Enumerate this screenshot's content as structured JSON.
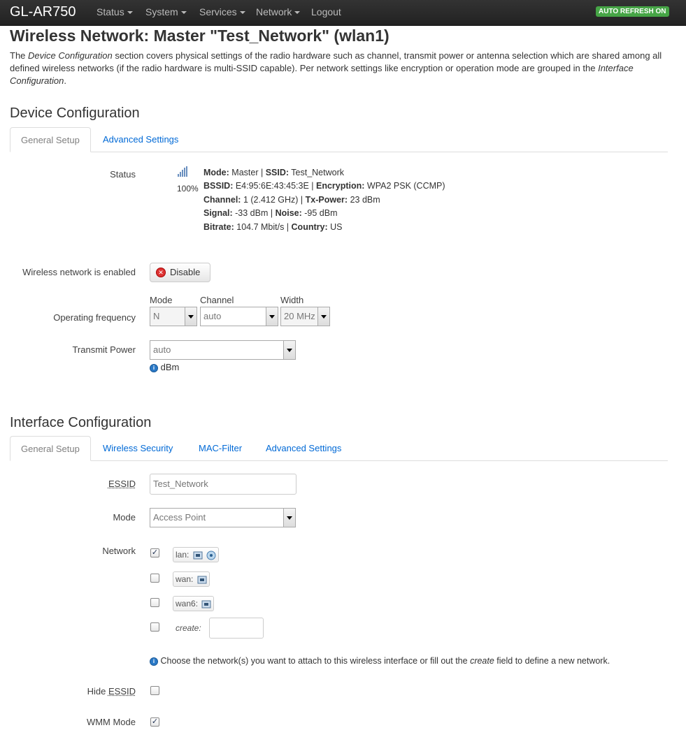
{
  "nav": {
    "brand": "GL-AR750",
    "menu": [
      "Status",
      "System",
      "Services",
      "Network",
      "Logout"
    ],
    "badge": "AUTO REFRESH ON"
  },
  "page": {
    "title": "Wireless Network: Master \"Test_Network\" (wlan1)",
    "desc_p1": "The ",
    "desc_i1": "Device Configuration",
    "desc_p2": " section covers physical settings of the radio hardware such as channel, transmit power or antenna selection which are shared among all defined wireless networks (if the radio hardware is multi-SSID capable). Per network settings like encryption or operation mode are grouped in the ",
    "desc_i2": "Interface Configuration",
    "desc_p3": "."
  },
  "device": {
    "heading": "Device Configuration",
    "tabs": [
      "General Setup",
      "Advanced Settings"
    ],
    "status_label": "Status",
    "signal_percent": "100%",
    "status_lines": [
      [
        {
          "k": "Mode:",
          "v": " Master | "
        },
        {
          "k": "SSID:",
          "v": " Test_Network"
        }
      ],
      [
        {
          "k": "BSSID:",
          "v": " E4:95:6E:43:45:3E | "
        },
        {
          "k": "Encryption:",
          "v": " WPA2 PSK (CCMP)"
        }
      ],
      [
        {
          "k": "Channel:",
          "v": " 1 (2.412 GHz) | "
        },
        {
          "k": "Tx-Power:",
          "v": " 23 dBm"
        }
      ],
      [
        {
          "k": "Signal:",
          "v": " -33 dBm | "
        },
        {
          "k": "Noise:",
          "v": " -95 dBm"
        }
      ],
      [
        {
          "k": "Bitrate:",
          "v": " 104.7 Mbit/s | "
        },
        {
          "k": "Country:",
          "v": " US"
        }
      ]
    ],
    "enabled_label": "Wireless network is enabled",
    "disable_button": "Disable",
    "freq_label": "Operating frequency",
    "freq_mode_label": "Mode",
    "freq_channel_label": "Channel",
    "freq_width_label": "Width",
    "freq_mode_value": "N",
    "freq_channel_value": "auto",
    "freq_width_value": "20 MHz",
    "txpower_label": "Transmit Power",
    "txpower_value": "auto",
    "txpower_unit": "dBm"
  },
  "interface": {
    "heading": "Interface Configuration",
    "tabs": [
      "General Setup",
      "Wireless Security",
      "MAC-Filter",
      "Advanced Settings"
    ],
    "essid_label": "ESSID",
    "essid_value": "Test_Network",
    "mode_label": "Mode",
    "mode_value": "Access Point",
    "network_label": "Network",
    "networks": [
      {
        "name": "lan:",
        "checked": true
      },
      {
        "name": "wan:",
        "checked": false
      },
      {
        "name": "wan6:",
        "checked": false
      }
    ],
    "create_label": "create:",
    "create_value": "",
    "network_help_p1": "Choose the network(s) you want to attach to this wireless interface or fill out the ",
    "network_help_i": "create",
    "network_help_p2": " field to define a new network.",
    "hide_essid_label": "Hide ",
    "hide_essid_label_abbr": "ESSID",
    "hide_essid_checked": false,
    "wmm_label": "WMM Mode",
    "wmm_checked": true
  }
}
